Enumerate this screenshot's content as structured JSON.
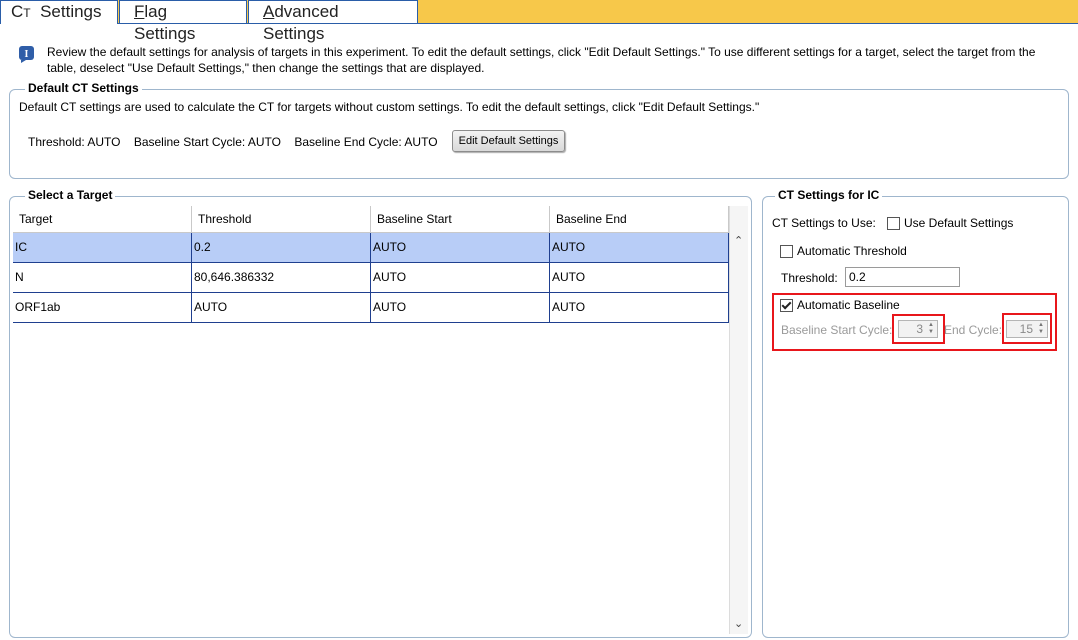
{
  "tabs": [
    {
      "label_pre": "C",
      "label_sub": "T",
      "label_post": "Settings",
      "full": "CT Settings"
    },
    {
      "label_ul": "F",
      "label_rest": "lag Settings"
    },
    {
      "label_ul": "A",
      "label_rest": "dvanced Settings"
    }
  ],
  "info": {
    "text": "Review the default settings for analysis of targets in this experiment. To edit the default settings, click \"Edit Default Settings.\" To use different settings for a target, select the target from the table, deselect \"Use Default Settings,\" then change the settings that are displayed."
  },
  "default_group": {
    "legend": "Default CT Settings",
    "description": "Default CT settings are used to calculate the CT for targets without custom settings. To edit the default settings, click \"Edit Default Settings.\"",
    "threshold": "Threshold: AUTO",
    "baseline_start": "Baseline Start Cycle: AUTO",
    "baseline_end": "Baseline End Cycle: AUTO",
    "edit_button": "Edit Default Settings"
  },
  "target_group": {
    "legend": "Select a Target",
    "columns": [
      "Target",
      "Threshold",
      "Baseline Start",
      "Baseline End"
    ],
    "rows": [
      [
        "IC",
        "0.2",
        "AUTO",
        "AUTO"
      ],
      [
        "N",
        "80,646.386332",
        "AUTO",
        "AUTO"
      ],
      [
        "ORF1ab",
        "AUTO",
        "AUTO",
        "AUTO"
      ]
    ]
  },
  "settings_group": {
    "legend": "CT Settings for IC",
    "settings_to_use": "CT Settings to Use:",
    "use_default": "Use Default Settings",
    "use_default_checked": false,
    "auto_threshold": "Automatic Threshold",
    "auto_threshold_checked": false,
    "threshold_label": "Threshold:",
    "threshold_value": "0.2",
    "auto_baseline": "Automatic Baseline",
    "auto_baseline_checked": true,
    "baseline_start_label": "Baseline Start Cycle:",
    "baseline_start_value": "3",
    "end_cycle_label": "End Cycle:",
    "end_cycle_value": "15"
  },
  "colors": {
    "tab_bar": "#f7c84a",
    "selected_row": "#b8cdf7",
    "highlight": "#e8161b"
  }
}
